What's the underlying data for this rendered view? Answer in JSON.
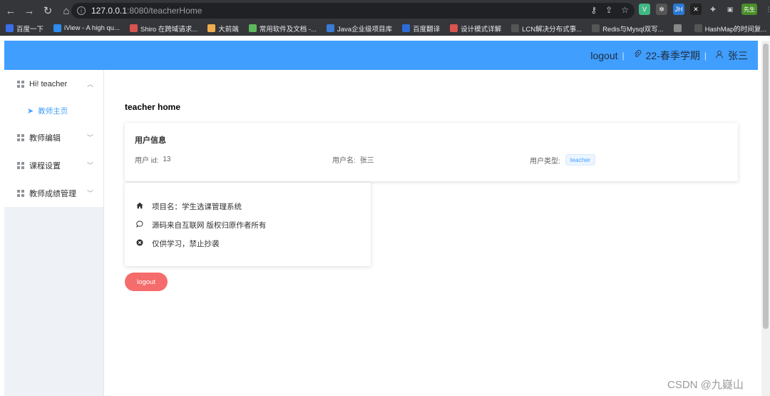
{
  "browser": {
    "url_host": "127.0.0.1",
    "url_rest": ":8080/teacherHome",
    "ext_jh": "JH",
    "ext_avatar": "先生",
    "bookmarks": [
      {
        "label": "百度一下",
        "color": "#3a6ee8"
      },
      {
        "label": "iView - A high qu...",
        "color": "#2d8cf0"
      },
      {
        "label": "Shiro 在跨域请求...",
        "color": "#d9534f"
      },
      {
        "label": "大前端",
        "color": "#f0ad4e"
      },
      {
        "label": "常用软件及文档 -...",
        "color": "#5cb85c"
      },
      {
        "label": "Java企业级项目库",
        "color": "#3a7bd5"
      },
      {
        "label": "百度翻译",
        "color": "#2f6bd8"
      },
      {
        "label": "设计模式详解",
        "color": "#d9534f"
      },
      {
        "label": "LCN解决分布式事...",
        "color": "#555"
      },
      {
        "label": "Redis与Mysql双写...",
        "color": "#555"
      },
      {
        "label": "",
        "color": "#888"
      },
      {
        "label": "HashMap的时间复...",
        "color": "#555"
      }
    ]
  },
  "header": {
    "logout": "logout",
    "separator": "|",
    "semester": "22-春季学期",
    "username": "张三"
  },
  "sidebar": {
    "items": [
      {
        "label": "Hi! teacher",
        "chevron": "︿"
      },
      {
        "label": "教师编辑",
        "chevron": "﹀"
      },
      {
        "label": "课程设置",
        "chevron": "﹀"
      },
      {
        "label": "教师成绩管理",
        "chevron": "﹀"
      }
    ],
    "sub_item": "教师主页"
  },
  "main": {
    "title": "teacher home",
    "user_card": {
      "title": "用户信息",
      "id_label": "用户 id:",
      "id_value": "13",
      "name_label": "用户名:",
      "name_value": "张三",
      "type_label": "用户类型:",
      "type_value": "teacher"
    },
    "info_lines": [
      {
        "icon": "home-icon",
        "glyph": "⌂",
        "text": "项目名：学生选课管理系统"
      },
      {
        "icon": "chat-bubble-icon",
        "glyph": "◯",
        "text": "源码来自互联网 版权归原作者所有"
      },
      {
        "icon": "circle-close-icon",
        "glyph": "✖",
        "text": "仅供学习，禁止抄袭"
      }
    ],
    "logout_button": "logout"
  },
  "watermark": "CSDN @九嶷山",
  "colors": {
    "primary": "#409eff",
    "danger": "#f56c6c",
    "sidebar_bg": "#eef1f6"
  }
}
